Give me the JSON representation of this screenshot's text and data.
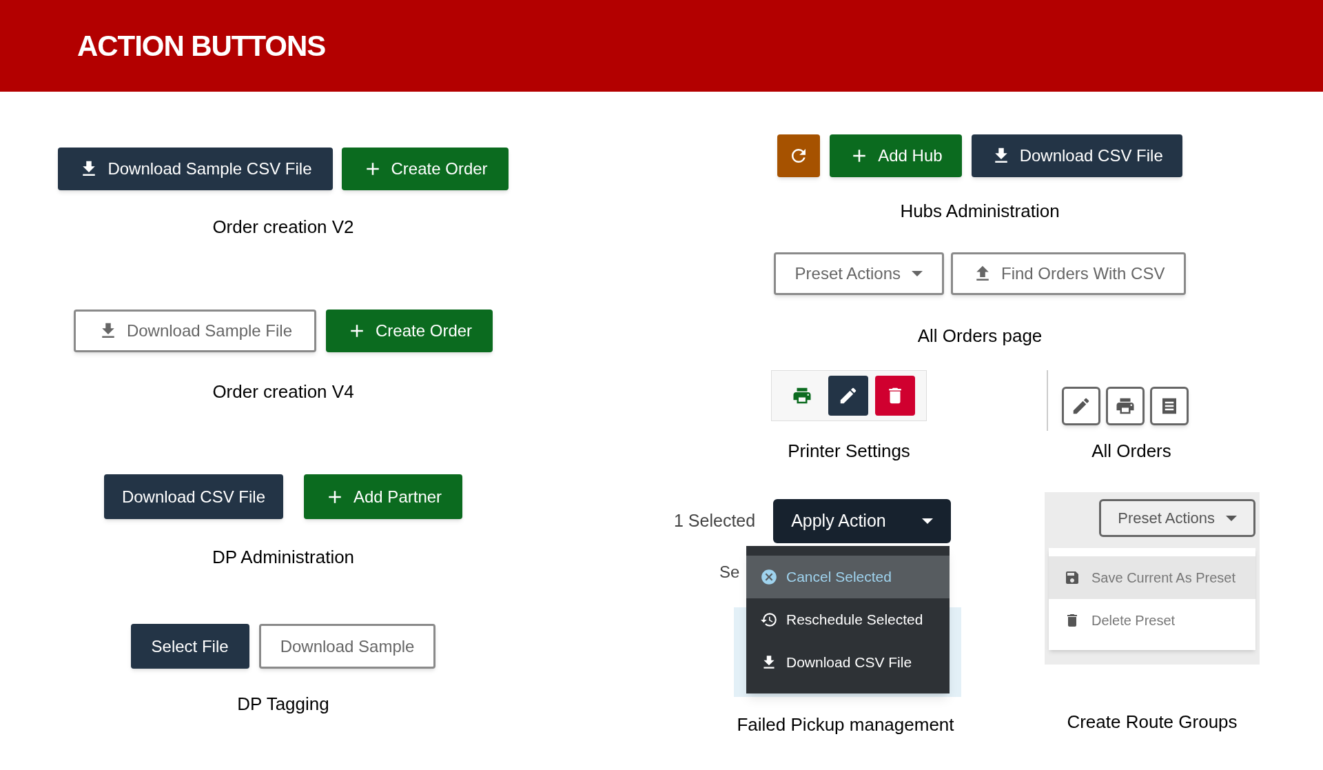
{
  "header": {
    "title": "ACTION BUTTONS"
  },
  "order_creation_v2": {
    "buttons": [
      "Download Sample CSV File",
      "Create Order"
    ],
    "caption": "Order creation V2"
  },
  "order_creation_v4": {
    "buttons": [
      "Download Sample File",
      "Create Order"
    ],
    "caption": "Order creation V4"
  },
  "dp_administration": {
    "buttons": [
      "Download CSV File",
      "Add Partner"
    ],
    "caption": "DP Administration"
  },
  "dp_tagging": {
    "buttons": [
      "Select File",
      "Download Sample"
    ],
    "caption": "DP Tagging"
  },
  "hubs_administration": {
    "buttons": [
      "Add Hub",
      "Download CSV File"
    ],
    "caption": "Hubs Administration"
  },
  "all_orders_page": {
    "buttons": [
      "Preset Actions",
      "Find Orders With CSV"
    ],
    "caption": "All Orders page"
  },
  "printer_settings": {
    "caption": "Printer Settings"
  },
  "all_orders": {
    "caption": "All Orders"
  },
  "failed_pickup_management": {
    "selection_count": "1 Selected",
    "button": "Apply Action",
    "covered_text": "Se",
    "menu": [
      {
        "label": "Cancel Selected",
        "selected": true
      },
      {
        "label": "Reschedule Selected",
        "selected": false
      },
      {
        "label": "Download CSV File",
        "selected": false
      }
    ],
    "caption": "Failed Pickup management"
  },
  "create_route_groups": {
    "button": "Preset Actions",
    "menu": [
      {
        "label": "Save Current As Preset",
        "selected": true
      },
      {
        "label": "Delete Preset",
        "selected": false
      }
    ],
    "caption": "Create Route Groups"
  }
}
